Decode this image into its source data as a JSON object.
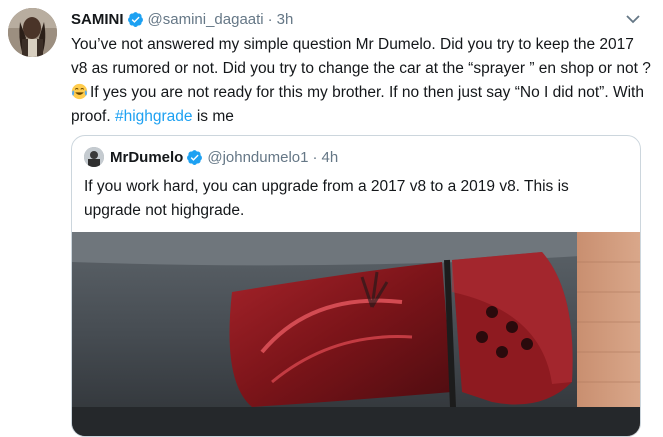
{
  "tweet": {
    "display_name": "SAMINI",
    "handle": "@samini_dagaati",
    "separator": "·",
    "time": "3h",
    "text_part1": "You’ve not answered my simple question Mr Dumelo. Did you try to keep the 2017 v8 as rumored or not. Did you try to change the car at the “sprayer ” en shop or not ? ",
    "text_part2": "If yes you are not ready for this my brother. If no then just say “No I did not”. With proof. ",
    "hashtag": "#highgrade",
    "text_part3": " is me",
    "emoji": "tears-of-joy-emoji"
  },
  "quoted_tweet": {
    "display_name": "MrDumelo",
    "handle": "@johndumelo1",
    "separator": "·",
    "time": "4h",
    "text": "If you work hard, you can upgrade from a 2017 v8 to a 2019 v8. This is upgrade not highgrade."
  },
  "colors": {
    "link": "#1da1f2",
    "secondary_text": "#657786",
    "border": "#ccd6dd",
    "verified": "#1da1f2"
  },
  "icons": [
    "verified-badge-icon",
    "chevron-down-icon",
    "tears-of-joy-emoji"
  ]
}
